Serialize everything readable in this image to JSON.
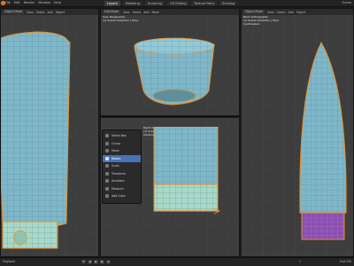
{
  "app": {
    "name": "Blender"
  },
  "topbar": {
    "menu": [
      "File",
      "Edit",
      "Render",
      "Window",
      "Help"
    ],
    "workspace_tabs": [
      "Layout",
      "Modeling",
      "Sculpting",
      "UV Editing",
      "Texture Paint",
      "Shading"
    ],
    "active_tab_index": 0,
    "scene_label": "Scene"
  },
  "viewports": {
    "left": {
      "mode_label": "Object Mode",
      "menus": [
        "View",
        "Select",
        "Add",
        "Object"
      ]
    },
    "mid_top": {
      "mode_label": "Edit Mode",
      "menus": [
        "View",
        "Select",
        "Add",
        "Mesh"
      ],
      "info_line1": "User Perspective",
      "info_line2": "(1) Scene Collection | Tube"
    },
    "mid_bottom": {
      "info_line1": "Right Orthographic",
      "info_line2": "(1) Scene Collection | Tube",
      "info_line3": "Centimeters"
    },
    "right": {
      "mode_label": "Object Mode",
      "menus": [
        "View",
        "Select",
        "Add",
        "Object"
      ],
      "info_line1": "Back Orthographic",
      "info_line2": "(1) Scene Collection | Tube",
      "info_line3": "Centimeters"
    }
  },
  "midbar": {
    "menus": [
      "Object",
      "View",
      "Select",
      "Add",
      "Object"
    ]
  },
  "tool_menu": {
    "items": [
      "Select Box",
      "Cursor",
      "Move",
      "Rotate",
      "Scale",
      "Transform",
      "Annotate",
      "Measure",
      "Add Cube"
    ],
    "active_index": 3
  },
  "timeline": {
    "left_label": "Playback",
    "frame_label": "1",
    "right_label": "End 250"
  },
  "colors": {
    "mesh_fill": "#7fb7c8",
    "mesh_edge": "#e8902a",
    "wire": "#5a8e9c",
    "selected_face": "#8a4fb0"
  }
}
